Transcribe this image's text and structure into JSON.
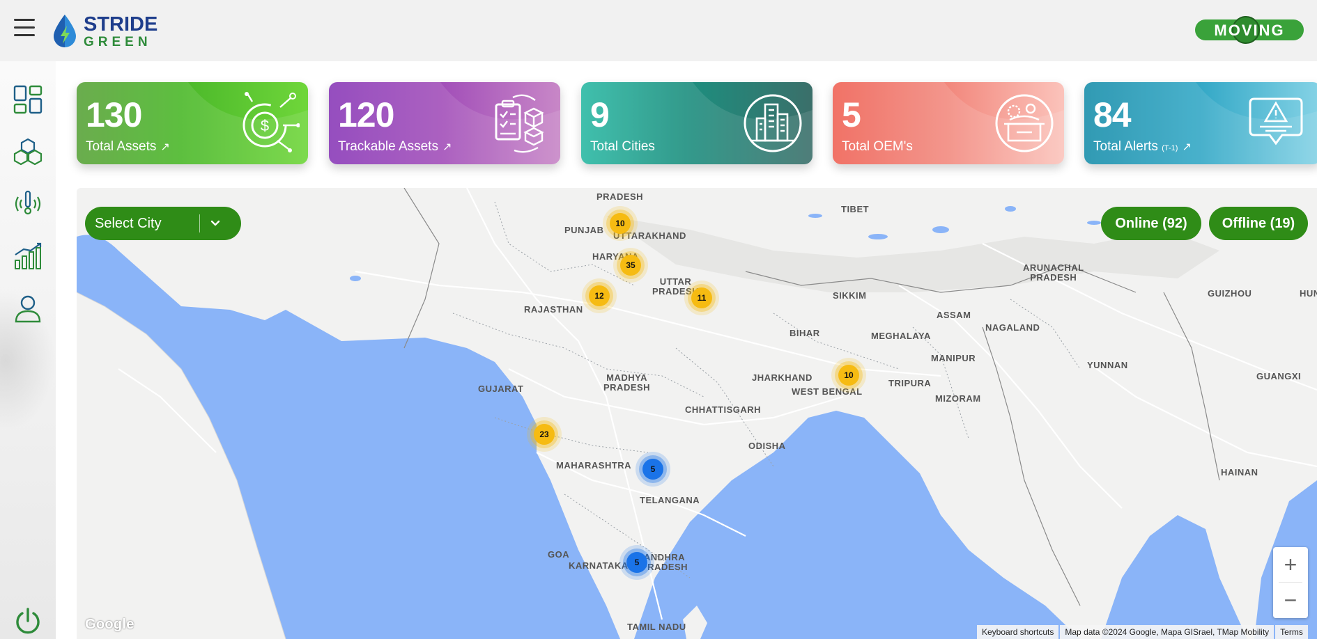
{
  "header": {
    "brand_line1": "STRIDE",
    "brand_line2": "GREEN",
    "partner_logo_text": "MOVING"
  },
  "sidebar": {
    "items": [
      {
        "icon": "dashboard-grid-icon"
      },
      {
        "icon": "assets-boxes-icon"
      },
      {
        "icon": "tracker-signal-icon"
      },
      {
        "icon": "analytics-chart-icon"
      },
      {
        "icon": "user-profile-icon"
      }
    ],
    "bottom_icon": "power-icon"
  },
  "cards": [
    {
      "value": "130",
      "label": "Total Assets",
      "arrow": "↗",
      "icon": "dollar-target-icon"
    },
    {
      "value": "120",
      "label": "Trackable Assets",
      "arrow": "↗",
      "icon": "clipboard-boxes-icon"
    },
    {
      "value": "9",
      "label": "Total Cities",
      "icon": "city-buildings-icon"
    },
    {
      "value": "5",
      "label": "Total OEM's",
      "icon": "factory-box-icon"
    },
    {
      "value": "84",
      "label": "Total Alerts",
      "suffix": "(T-1)",
      "arrow": "↗",
      "icon": "alert-message-icon"
    }
  ],
  "map": {
    "city_select": {
      "label": "Select City"
    },
    "status": {
      "online": "Online (92)",
      "offline": "Offline (19)"
    },
    "regions": [
      "PRADESH",
      "PUNJAB",
      "UTTARAKHAND",
      "HARYANA",
      "UTTAR\nPRADESH",
      "RAJASTHAN",
      "TIBET",
      "ARUNACHAL\nPRADESH",
      "SIKKIM",
      "GUIZHOU",
      "HUN",
      "ASSAM",
      "NAGALAND",
      "BIHAR",
      "MEGHALAYA",
      "MANIPUR",
      "YUNNAN",
      "GUANGXI",
      "JHARKHAND",
      "WEST BENGAL",
      "TRIPURA",
      "MIZORAM",
      "GUJARAT",
      "MADHYA\nPRADESH",
      "CHHATTISGARH",
      "ODISHA",
      "MAHARASHTRA",
      "TELANGANA",
      "HAINAN",
      "GOA",
      "KARNATAKA",
      "ANDHRA\nPRADESH",
      "TAMIL NADU"
    ],
    "clusters": [
      {
        "count": "10",
        "type": "offline-heavy"
      },
      {
        "count": "35",
        "type": "offline-heavy"
      },
      {
        "count": "12",
        "type": "offline-heavy"
      },
      {
        "count": "11",
        "type": "offline-heavy"
      },
      {
        "count": "10",
        "type": "offline-heavy"
      },
      {
        "count": "23",
        "type": "offline-heavy"
      },
      {
        "count": "5",
        "type": "online"
      },
      {
        "count": "5",
        "type": "online"
      }
    ],
    "zoom_in": "+",
    "zoom_out": "−",
    "google_logo": "Google",
    "attribution": {
      "shortcuts": "Keyboard shortcuts",
      "data": "Map data ©2024 Google, Mapa GISrael, TMap Mobility",
      "terms": "Terms"
    }
  },
  "colors": {
    "primary_green": "#2f8c17",
    "cluster_yellow": "#f6bb12",
    "cluster_blue": "#1a73e8",
    "water": "#8ab4f8"
  }
}
